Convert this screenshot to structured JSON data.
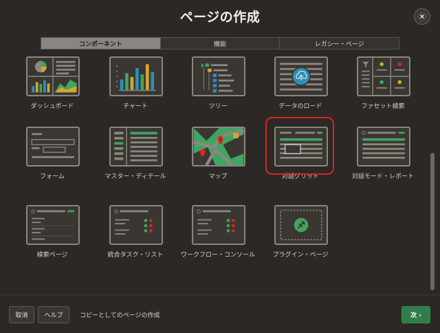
{
  "dialog": {
    "title": "ページの作成",
    "close_icon": "close-x-icon"
  },
  "tabs": [
    {
      "label": "コンポーネント",
      "active": true
    },
    {
      "label": "機能",
      "active": false
    },
    {
      "label": "レガシー・ページ",
      "active": false
    }
  ],
  "components": [
    {
      "label": "ダッシュボード",
      "icon": "dashboard-icon"
    },
    {
      "label": "チャート",
      "icon": "chart-icon"
    },
    {
      "label": "ツリー",
      "icon": "tree-icon"
    },
    {
      "label": "データのロード",
      "icon": "data-load-icon"
    },
    {
      "label": "ファセット検索",
      "icon": "faceted-search-icon"
    },
    {
      "label": "フォーム",
      "icon": "form-icon"
    },
    {
      "label": "マスター・ディテール",
      "icon": "master-detail-icon"
    },
    {
      "label": "マップ",
      "icon": "map-icon"
    },
    {
      "label": "対話グリッド",
      "icon": "interactive-grid-icon",
      "selected": true
    },
    {
      "label": "対話モード・レポート",
      "icon": "interactive-report-icon"
    },
    {
      "label": "検索ページ",
      "icon": "search-page-icon"
    },
    {
      "label": "統合タスク・リスト",
      "icon": "task-list-icon"
    },
    {
      "label": "ワークフロー・コンソール",
      "icon": "workflow-console-icon"
    },
    {
      "label": "プラグイン・ページ",
      "icon": "plugin-icon"
    }
  ],
  "footer": {
    "cancel_label": "取消",
    "help_label": "ヘルプ",
    "copy_label": "コピーとしてのページの作成",
    "next_label": "次 ›"
  },
  "colors": {
    "accent_green": "#2e7d4a",
    "selection_red": "#d5281b",
    "thumb_green": "#3fa560"
  }
}
